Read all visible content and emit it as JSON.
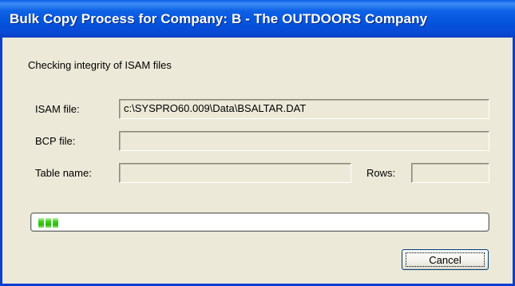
{
  "window": {
    "title": "Bulk Copy Process for Company: B - The OUTDOORS Company"
  },
  "status_text": "Checking integrity of ISAM files",
  "fields": {
    "isam_file": {
      "label": "ISAM file:",
      "value": "c:\\SYSPRO60.009\\Data\\BSALTAR.DAT"
    },
    "bcp_file": {
      "label": "BCP file:",
      "value": ""
    },
    "table_name": {
      "label": "Table name:",
      "value": ""
    },
    "rows": {
      "label": "Rows:",
      "value": ""
    }
  },
  "progress": {
    "blocks_filled": 3
  },
  "buttons": {
    "cancel_label": "Cancel"
  },
  "colors": {
    "titlebar": "#0553dc",
    "dialog_background": "#ece9d8",
    "progress_fill": "#40d11c"
  }
}
